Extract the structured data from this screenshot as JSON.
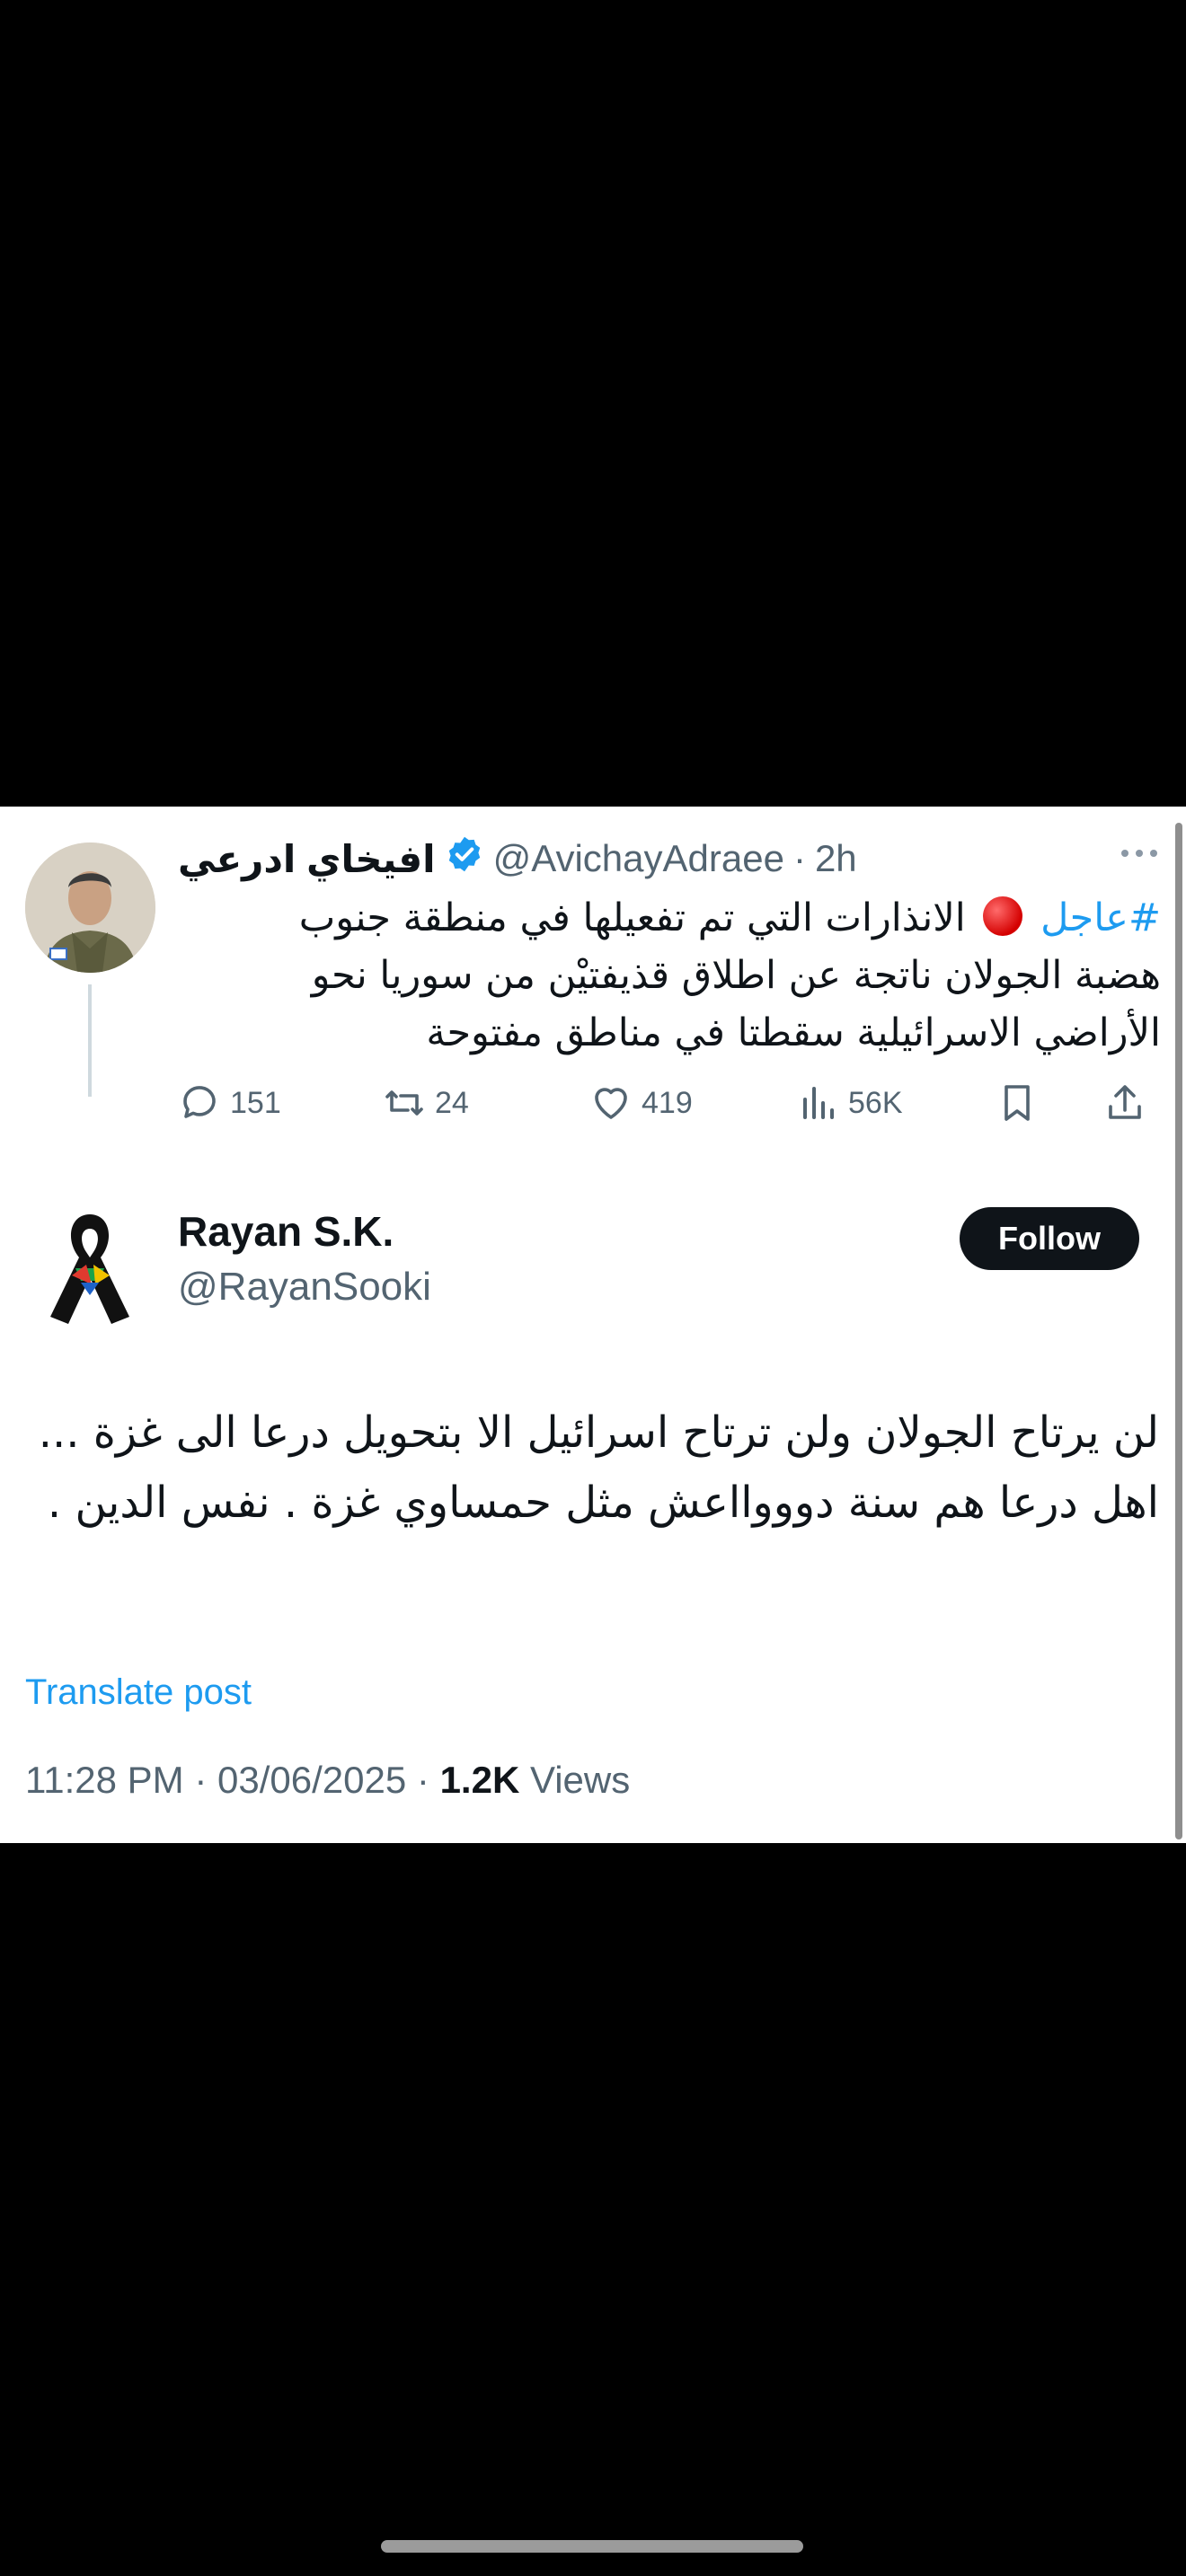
{
  "original_tweet": {
    "author_name": "افيخاي ادرعي",
    "verified": true,
    "handle": "@AvichayAdraee",
    "separator": "·",
    "time": "2h",
    "hashtag": "#عاجل",
    "text": "الانذارات التي تم تفعيلها في منطقة جنوب هضبة الجولان ناتجة عن اطلاق قذيفتيْن من سوريا نحو الأراضي الاسرائيلية سقطتا في مناطق مفتوحة",
    "stats": {
      "replies": "151",
      "reposts": "24",
      "likes": "419",
      "views": "56K"
    }
  },
  "reply": {
    "author_name": "Rayan S.K.",
    "handle": "@RayanSooki",
    "follow_label": "Follow",
    "text": "لن يرتاح الجولان ولن ترتاح اسرائيل الا بتحويل درعا الى غزة ... اهل درعا هم سنة دوووااعش مثل حمساوي غزة . نفس الدين .",
    "translate_label": "Translate post",
    "timestamp": "11:28 PM",
    "date": "03/06/2025",
    "view_count": "1.2K",
    "views_label": "Views",
    "meta_sep": "·"
  },
  "colors": {
    "accent": "#1d9bf0",
    "text_primary": "#0f1419",
    "text_secondary": "#536471",
    "red_dot": "#d40000"
  }
}
